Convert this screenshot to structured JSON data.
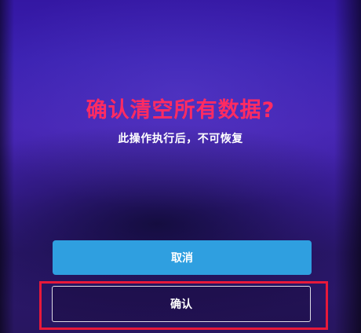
{
  "dialog": {
    "title": "确认清空所有数据?",
    "subtitle": "此操作执行后，不可恢复",
    "cancel_label": "取消",
    "confirm_label": "确认"
  },
  "colors": {
    "title": "#ff2b62",
    "cancel_button": "#2f9fe0",
    "highlight_frame": "#e8193a",
    "background": "#3a20b0"
  }
}
